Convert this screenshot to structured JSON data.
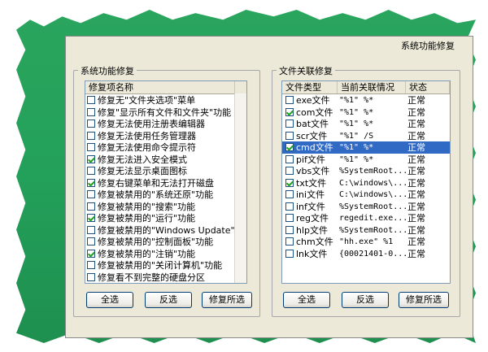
{
  "window": {
    "title": "系统功能修复"
  },
  "left_panel": {
    "title": "系统功能修复",
    "column": "修复项名称",
    "items": [
      {
        "label": "修复无\"文件夹选项\"菜单",
        "checked": false
      },
      {
        "label": "修复\"显示所有文件和文件夹\"功能",
        "checked": false
      },
      {
        "label": "修复无法使用注册表编辑器",
        "checked": false
      },
      {
        "label": "修复无法使用任务管理器",
        "checked": false
      },
      {
        "label": "修复无法使用命令提示符",
        "checked": false
      },
      {
        "label": "修复无法进入安全模式",
        "checked": true
      },
      {
        "label": "修复无法显示桌面图标",
        "checked": false
      },
      {
        "label": "修复右键菜单和无法打开磁盘",
        "checked": true
      },
      {
        "label": "修复被禁用的\"系统还原\"功能",
        "checked": false
      },
      {
        "label": "修复被禁用的\"搜索\"功能",
        "checked": false
      },
      {
        "label": "修复被禁用的\"运行\"功能",
        "checked": true
      },
      {
        "label": "修复被禁用的\"Windows Update\"",
        "checked": false
      },
      {
        "label": "修复被禁用的\"控制面板\"功能",
        "checked": false
      },
      {
        "label": "修复被禁用的\"注销\"功能",
        "checked": true
      },
      {
        "label": "修复被禁用的\"关闭计算机\"功能",
        "checked": false
      },
      {
        "label": "修复看不到完整的硬盘分区",
        "checked": false
      }
    ],
    "buttons": {
      "select_all": "全选",
      "invert": "反选",
      "repair": "修复所选"
    }
  },
  "right_panel": {
    "title": "文件关联修复",
    "columns": [
      "文件类型",
      "当前关联情况",
      "状态"
    ],
    "rows": [
      {
        "type": "exe文件",
        "assoc": "\"%1\" %*",
        "status": "正常",
        "checked": false,
        "selected": false
      },
      {
        "type": "com文件",
        "assoc": "\"%1\" %*",
        "status": "正常",
        "checked": true,
        "selected": false
      },
      {
        "type": "bat文件",
        "assoc": "\"%1\" %*",
        "status": "正常",
        "checked": false,
        "selected": false
      },
      {
        "type": "scr文件",
        "assoc": "\"%1\" /S",
        "status": "正常",
        "checked": false,
        "selected": false
      },
      {
        "type": "cmd文件",
        "assoc": "\"%1\" %*",
        "status": "正常",
        "checked": true,
        "selected": true
      },
      {
        "type": "pif文件",
        "assoc": "\"%1\" %*",
        "status": "正常",
        "checked": false,
        "selected": false
      },
      {
        "type": "vbs文件",
        "assoc": "%SystemRoot...",
        "status": "正常",
        "checked": false,
        "selected": false
      },
      {
        "type": "txt文件",
        "assoc": "C:\\windows\\...",
        "status": "正常",
        "checked": true,
        "selected": false
      },
      {
        "type": "ini文件",
        "assoc": "C:\\windows\\...",
        "status": "正常",
        "checked": false,
        "selected": false
      },
      {
        "type": "inf文件",
        "assoc": "%SystemRoot...",
        "status": "正常",
        "checked": false,
        "selected": false
      },
      {
        "type": "reg文件",
        "assoc": "regedit.exe...",
        "status": "正常",
        "checked": false,
        "selected": false
      },
      {
        "type": "hlp文件",
        "assoc": "%SystemRoot...",
        "status": "正常",
        "checked": false,
        "selected": false
      },
      {
        "type": "chm文件",
        "assoc": "\"hh.exe\" %1",
        "status": "正常",
        "checked": false,
        "selected": false
      },
      {
        "type": "lnk文件",
        "assoc": "{00021401-0...",
        "status": "正常",
        "checked": false,
        "selected": false
      }
    ],
    "buttons": {
      "select_all": "全选",
      "invert": "反选",
      "repair": "修复所选"
    }
  }
}
